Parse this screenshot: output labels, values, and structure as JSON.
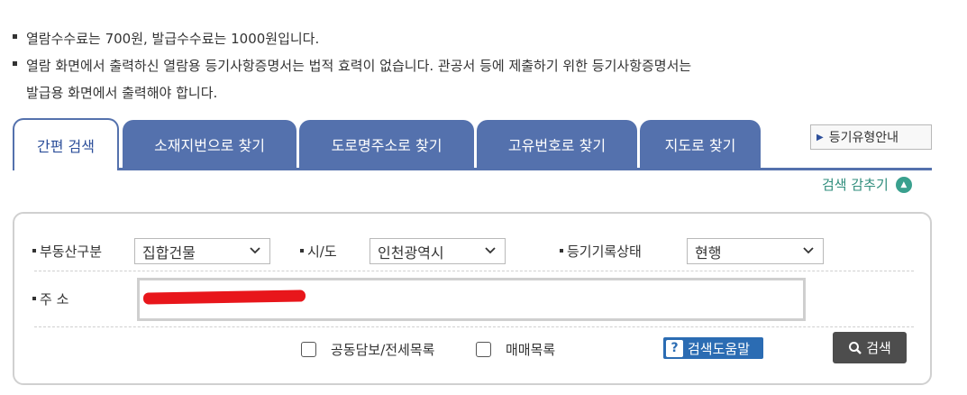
{
  "notices": [
    "열람수수료는 700원, 발급수수료는 1000원입니다.",
    "열람 화면에서 출력하신 열람용 등기사항증명서는 법적 효력이 없습니다. 관공서 등에 제출하기 위한 등기사항증명서는",
    "발급용 화면에서 출력해야 합니다."
  ],
  "tabs": {
    "active": "간편 검색",
    "items": [
      "소재지번으로 찾기",
      "도로명주소로 찾기",
      "고유번호로 찾기",
      "지도로 찾기"
    ]
  },
  "guide_button": "등기유형안내",
  "hide_search": "검색 감추기",
  "form": {
    "property_type": {
      "label": "부동산구분",
      "value": "집합건물"
    },
    "region": {
      "label": "시/도",
      "value": "인천광역시"
    },
    "record_status": {
      "label": "등기기록상태",
      "value": "현행"
    },
    "address": {
      "label": "주 소",
      "value": ""
    },
    "checkbox_joint": "공동담보/전세목록",
    "checkbox_sale": "매매목록",
    "help_button": "검색도움말",
    "search_button": "검색"
  },
  "colors": {
    "tab_blue": "#5471ad",
    "teal": "#39a08e",
    "help_blue": "#2b6cb3",
    "search_dark": "#4d4d4d",
    "redaction": "#e8161b"
  }
}
